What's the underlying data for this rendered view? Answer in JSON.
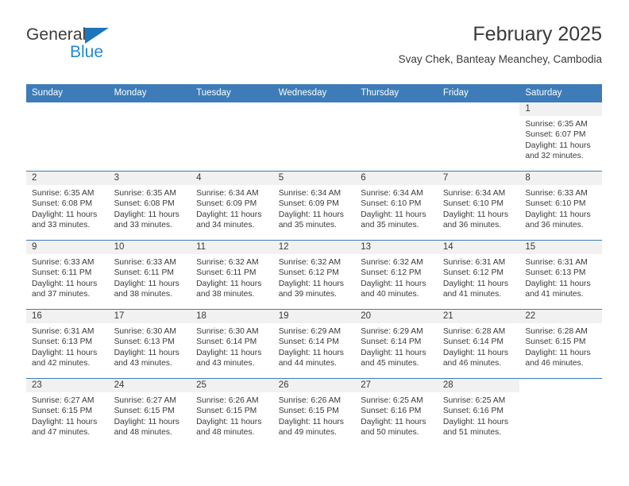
{
  "brand": {
    "name_part1": "General",
    "name_part2": "Blue",
    "triangle_color": "#1b76bc",
    "blue_color": "#2389cf"
  },
  "header": {
    "title": "February 2025",
    "subtitle": "Svay Chek, Banteay Meanchey, Cambodia"
  },
  "theme": {
    "header_blue": "#3d7cb8",
    "band_gray": "#f1f1f1",
    "text": "#3a3a3a"
  },
  "calendar": {
    "weekday_headers": [
      "Sunday",
      "Monday",
      "Tuesday",
      "Wednesday",
      "Thursday",
      "Friday",
      "Saturday"
    ],
    "weeks": [
      [
        {
          "day": "",
          "lines": [],
          "blank": true
        },
        {
          "day": "",
          "lines": [],
          "blank": true
        },
        {
          "day": "",
          "lines": [],
          "blank": true
        },
        {
          "day": "",
          "lines": [],
          "blank": true
        },
        {
          "day": "",
          "lines": [],
          "blank": true
        },
        {
          "day": "",
          "lines": [],
          "blank": true
        },
        {
          "day": "1",
          "sunrise": "Sunrise: 6:35 AM",
          "sunset": "Sunset: 6:07 PM",
          "daylight": "Daylight: 11 hours and 32 minutes."
        }
      ],
      [
        {
          "day": "2",
          "sunrise": "Sunrise: 6:35 AM",
          "sunset": "Sunset: 6:08 PM",
          "daylight": "Daylight: 11 hours and 33 minutes."
        },
        {
          "day": "3",
          "sunrise": "Sunrise: 6:35 AM",
          "sunset": "Sunset: 6:08 PM",
          "daylight": "Daylight: 11 hours and 33 minutes."
        },
        {
          "day": "4",
          "sunrise": "Sunrise: 6:34 AM",
          "sunset": "Sunset: 6:09 PM",
          "daylight": "Daylight: 11 hours and 34 minutes."
        },
        {
          "day": "5",
          "sunrise": "Sunrise: 6:34 AM",
          "sunset": "Sunset: 6:09 PM",
          "daylight": "Daylight: 11 hours and 35 minutes."
        },
        {
          "day": "6",
          "sunrise": "Sunrise: 6:34 AM",
          "sunset": "Sunset: 6:10 PM",
          "daylight": "Daylight: 11 hours and 35 minutes."
        },
        {
          "day": "7",
          "sunrise": "Sunrise: 6:34 AM",
          "sunset": "Sunset: 6:10 PM",
          "daylight": "Daylight: 11 hours and 36 minutes."
        },
        {
          "day": "8",
          "sunrise": "Sunrise: 6:33 AM",
          "sunset": "Sunset: 6:10 PM",
          "daylight": "Daylight: 11 hours and 36 minutes."
        }
      ],
      [
        {
          "day": "9",
          "sunrise": "Sunrise: 6:33 AM",
          "sunset": "Sunset: 6:11 PM",
          "daylight": "Daylight: 11 hours and 37 minutes."
        },
        {
          "day": "10",
          "sunrise": "Sunrise: 6:33 AM",
          "sunset": "Sunset: 6:11 PM",
          "daylight": "Daylight: 11 hours and 38 minutes."
        },
        {
          "day": "11",
          "sunrise": "Sunrise: 6:32 AM",
          "sunset": "Sunset: 6:11 PM",
          "daylight": "Daylight: 11 hours and 38 minutes."
        },
        {
          "day": "12",
          "sunrise": "Sunrise: 6:32 AM",
          "sunset": "Sunset: 6:12 PM",
          "daylight": "Daylight: 11 hours and 39 minutes."
        },
        {
          "day": "13",
          "sunrise": "Sunrise: 6:32 AM",
          "sunset": "Sunset: 6:12 PM",
          "daylight": "Daylight: 11 hours and 40 minutes."
        },
        {
          "day": "14",
          "sunrise": "Sunrise: 6:31 AM",
          "sunset": "Sunset: 6:12 PM",
          "daylight": "Daylight: 11 hours and 41 minutes."
        },
        {
          "day": "15",
          "sunrise": "Sunrise: 6:31 AM",
          "sunset": "Sunset: 6:13 PM",
          "daylight": "Daylight: 11 hours and 41 minutes."
        }
      ],
      [
        {
          "day": "16",
          "sunrise": "Sunrise: 6:31 AM",
          "sunset": "Sunset: 6:13 PM",
          "daylight": "Daylight: 11 hours and 42 minutes."
        },
        {
          "day": "17",
          "sunrise": "Sunrise: 6:30 AM",
          "sunset": "Sunset: 6:13 PM",
          "daylight": "Daylight: 11 hours and 43 minutes."
        },
        {
          "day": "18",
          "sunrise": "Sunrise: 6:30 AM",
          "sunset": "Sunset: 6:14 PM",
          "daylight": "Daylight: 11 hours and 43 minutes."
        },
        {
          "day": "19",
          "sunrise": "Sunrise: 6:29 AM",
          "sunset": "Sunset: 6:14 PM",
          "daylight": "Daylight: 11 hours and 44 minutes."
        },
        {
          "day": "20",
          "sunrise": "Sunrise: 6:29 AM",
          "sunset": "Sunset: 6:14 PM",
          "daylight": "Daylight: 11 hours and 45 minutes."
        },
        {
          "day": "21",
          "sunrise": "Sunrise: 6:28 AM",
          "sunset": "Sunset: 6:14 PM",
          "daylight": "Daylight: 11 hours and 46 minutes."
        },
        {
          "day": "22",
          "sunrise": "Sunrise: 6:28 AM",
          "sunset": "Sunset: 6:15 PM",
          "daylight": "Daylight: 11 hours and 46 minutes."
        }
      ],
      [
        {
          "day": "23",
          "sunrise": "Sunrise: 6:27 AM",
          "sunset": "Sunset: 6:15 PM",
          "daylight": "Daylight: 11 hours and 47 minutes."
        },
        {
          "day": "24",
          "sunrise": "Sunrise: 6:27 AM",
          "sunset": "Sunset: 6:15 PM",
          "daylight": "Daylight: 11 hours and 48 minutes."
        },
        {
          "day": "25",
          "sunrise": "Sunrise: 6:26 AM",
          "sunset": "Sunset: 6:15 PM",
          "daylight": "Daylight: 11 hours and 48 minutes."
        },
        {
          "day": "26",
          "sunrise": "Sunrise: 6:26 AM",
          "sunset": "Sunset: 6:15 PM",
          "daylight": "Daylight: 11 hours and 49 minutes."
        },
        {
          "day": "27",
          "sunrise": "Sunrise: 6:25 AM",
          "sunset": "Sunset: 6:16 PM",
          "daylight": "Daylight: 11 hours and 50 minutes."
        },
        {
          "day": "28",
          "sunrise": "Sunrise: 6:25 AM",
          "sunset": "Sunset: 6:16 PM",
          "daylight": "Daylight: 11 hours and 51 minutes."
        },
        {
          "day": "",
          "sunrise": "",
          "sunset": "",
          "daylight": "",
          "blank": true
        }
      ]
    ]
  }
}
